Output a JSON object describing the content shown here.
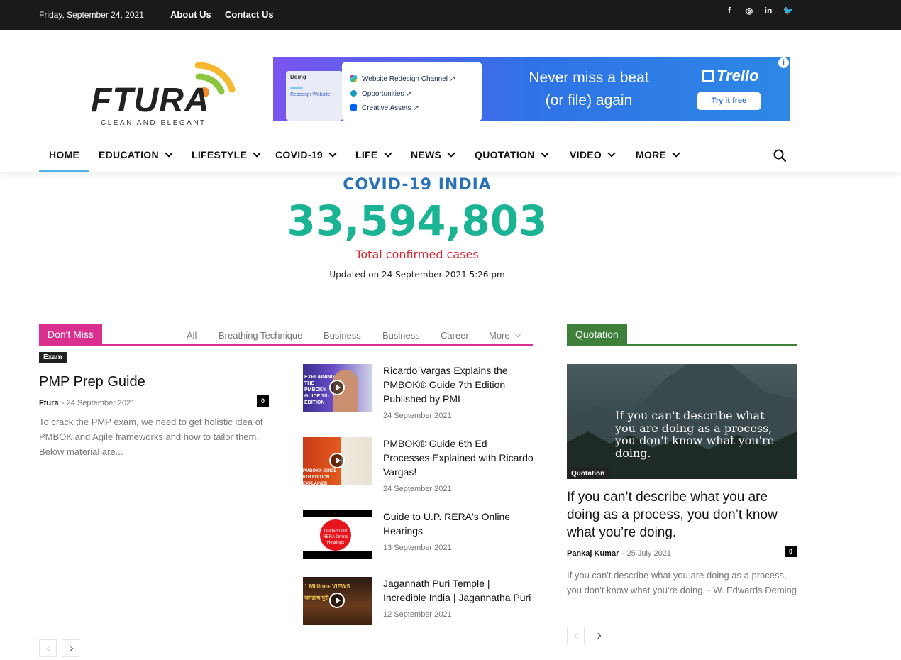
{
  "topbar": {
    "date": "Friday, September 24, 2021",
    "links": [
      "About Us",
      "Contact Us"
    ],
    "social": [
      "f",
      "◎",
      "in",
      "🐦"
    ]
  },
  "logo": {
    "name": "FTURA",
    "tagline": "CLEAN AND ELEGANT"
  },
  "ad": {
    "doing": "Doing",
    "card_title": "Redesign Website",
    "rows": [
      "Website Redesign Channel ↗",
      "Opportunities ↗",
      "Creative Assets ↗"
    ],
    "headline_line1": "Never miss a beat",
    "headline_line2": "(or file) again",
    "brand": "Trello",
    "cta": "Try it free",
    "info": "i"
  },
  "nav": {
    "items": [
      "HOME",
      "EDUCATION",
      "LIFESTYLE",
      "COVID-19",
      "LIFE",
      "NEWS",
      "QUOTATION",
      "VIDEO",
      "MORE"
    ]
  },
  "covid": {
    "title": "COVID-19 INDIA",
    "count": "33,594,803",
    "label": "Total confirmed cases",
    "updated": "Updated on 24 September 2021 5:26 pm"
  },
  "dont_miss": {
    "title": "Don't Miss",
    "filters": [
      "All",
      "Breathing Technique",
      "Business",
      "Business",
      "Career",
      "More"
    ],
    "main": {
      "category": "Exam",
      "title": "PMP Prep Guide",
      "author": "Ftura",
      "date": "24 September 2021",
      "comments": "0",
      "excerpt": "To crack the PMP exam, we need to get holistic idea of PMBOK and Agile frameworks and how to tailor them. Below material are..."
    },
    "items": [
      {
        "title": "Ricardo Vargas Explains the PMBOK® Guide 7th Edition Published by PMI",
        "date": "24 September 2021"
      },
      {
        "title": "PMBOK® Guide 6th Ed Processes Explained with Ricardo Vargas!",
        "date": "24 September 2021"
      },
      {
        "title": "Guide to U.P. RERA's Online Hearings",
        "date": "13 September 2021"
      },
      {
        "title": "Jagannath Puri Temple | Incredible India | Jagannatha Puri",
        "date": "12 September 2021"
      }
    ],
    "thumb_texts": [
      "EXPLAINING THE PMBOK® GUIDE 7th EDITION",
      "PMBOK® GUIDE 6TH EDITION EXPLAINED!",
      "Guide to UP RERA Online Hearings",
      "1 Million+ VIEWS जगन्नाथ पुरी"
    ]
  },
  "quotation": {
    "title": "Quotation",
    "image_quote": "If you can't describe what you are doing as a process, you don't know what you're doing.",
    "image_category": "Quotation",
    "post_title": "If you can’t describe what you are doing as a process, you don’t know what you’re doing.",
    "author": "Pankaj Kumar",
    "date": "25 July 2021",
    "comments": "0",
    "excerpt": "If you can't describe what you are doing as a process, you don't know what you're doing.~ W. Edwards Deming"
  },
  "colors": {
    "dont_miss": "#d92f8e",
    "quotation": "#3e7f3a",
    "covid_num": "#1ab394",
    "covid_title": "#2a72b8",
    "covid_label": "#d9282f"
  }
}
